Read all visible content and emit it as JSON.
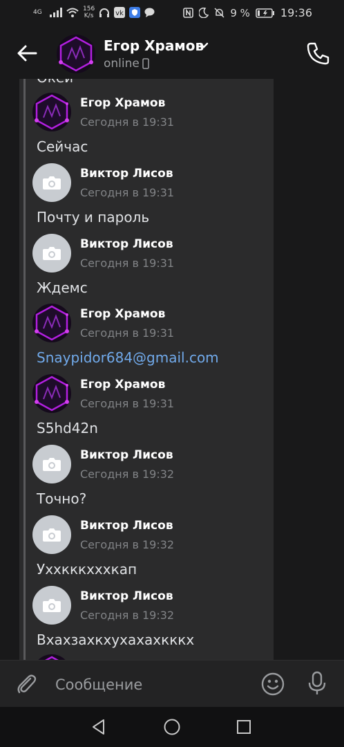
{
  "status_bar": {
    "network": "4G",
    "speed_value": "156",
    "speed_unit": "K/s",
    "battery_percent": "9 %",
    "time": "19:36"
  },
  "header": {
    "name": "Егор Храмов",
    "status": "online"
  },
  "thread": {
    "peek_text": "Окей",
    "messages": [
      {
        "author": "Егор Храмов",
        "time": "Сегодня в 19:31",
        "text": "Сейчас",
        "avatar": "purple-photo"
      },
      {
        "author": "Виктор Лисов",
        "time": "Сегодня в 19:31",
        "text": "Почту и пароль",
        "avatar": "camera-placeholder"
      },
      {
        "author": "Виктор Лисов",
        "time": "Сегодня в 19:31",
        "text": "Ждемс",
        "avatar": "camera-placeholder"
      },
      {
        "author": "Егор Храмов",
        "time": "Сегодня в 19:31",
        "text": "Snaypidor684@gmail.com",
        "avatar": "purple-photo"
      },
      {
        "author": "Егор Храмов",
        "time": "Сегодня в 19:31",
        "text": "S5hd42n",
        "avatar": "purple-photo"
      },
      {
        "author": "Виктор Лисов",
        "time": "Сегодня в 19:32",
        "text": "Точно?",
        "avatar": "camera-placeholder"
      },
      {
        "author": "Виктор Лисов",
        "time": "Сегодня в 19:32",
        "text": "Уххкккхххкап",
        "avatar": "camera-placeholder"
      },
      {
        "author": "Виктор Лисов",
        "time": "Сегодня в 19:32",
        "text": "Вхахзахкхухахахкккх",
        "avatar": "camera-placeholder"
      }
    ]
  },
  "composer": {
    "placeholder": "Сообщение"
  },
  "colors": {
    "background": "#19191a",
    "thread_bg": "#2b2b2c",
    "link": "#71aaeb",
    "secondary_text": "#828487",
    "avatar_placeholder": "#c8ccd1"
  },
  "icons": [
    "back-arrow-icon",
    "chevron-down-icon",
    "phone-call-icon",
    "camera-icon",
    "paperclip-icon",
    "emoji-icon",
    "microphone-icon"
  ]
}
